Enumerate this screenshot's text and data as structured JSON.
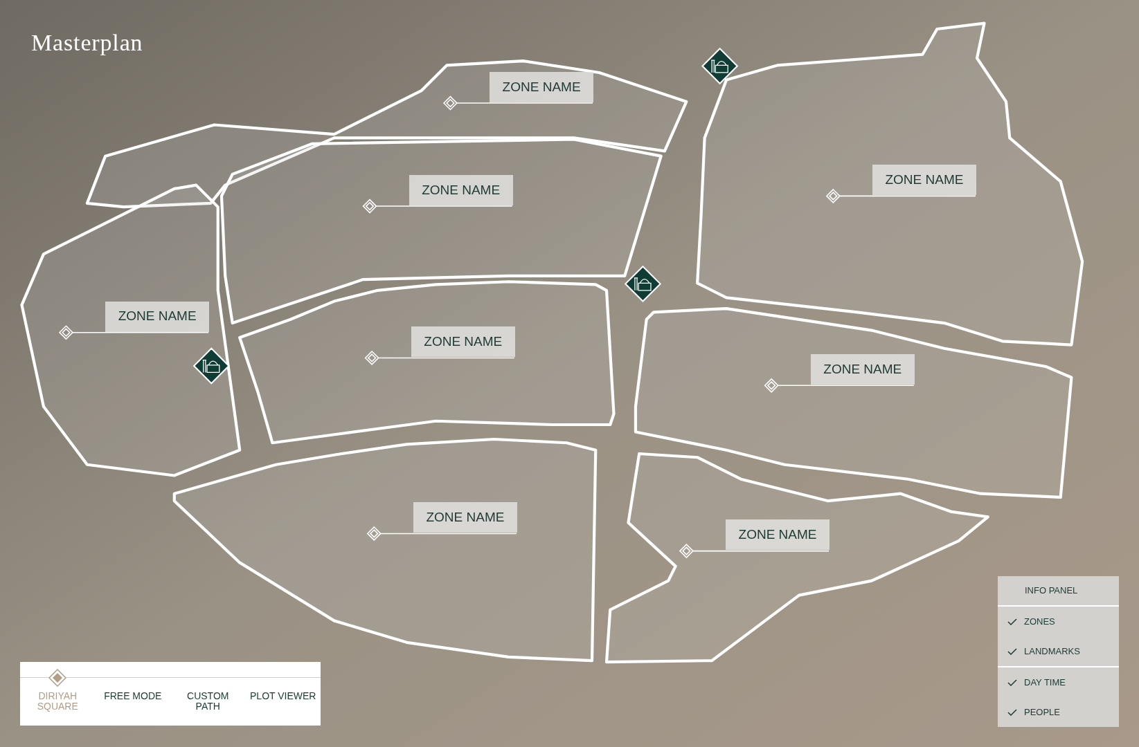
{
  "title": "Masterplan",
  "zones": [
    {
      "label": "ZONE NAME"
    },
    {
      "label": "ZONE NAME"
    },
    {
      "label": "ZONE NAME"
    },
    {
      "label": "ZONE NAME"
    },
    {
      "label": "ZONE NAME"
    },
    {
      "label": "ZONE NAME"
    },
    {
      "label": "ZONE NAME"
    },
    {
      "label": "ZONE NAME"
    }
  ],
  "nav": [
    {
      "label": "DIRIYAH SQUARE",
      "selected": true
    },
    {
      "label": "FREE MODE",
      "selected": false
    },
    {
      "label": "CUSTOM PATH",
      "selected": false
    },
    {
      "label": "PLOT VIEWER",
      "selected": false
    }
  ],
  "info_panel": {
    "title": "INFO PANEL",
    "sections": [
      {
        "items": [
          {
            "label": "ZONES",
            "checked": true
          },
          {
            "label": "LANDMARKS",
            "checked": true
          }
        ]
      },
      {
        "items": [
          {
            "label": "DAY TIME",
            "checked": true
          },
          {
            "label": "PEOPLE",
            "checked": true
          }
        ]
      }
    ]
  }
}
